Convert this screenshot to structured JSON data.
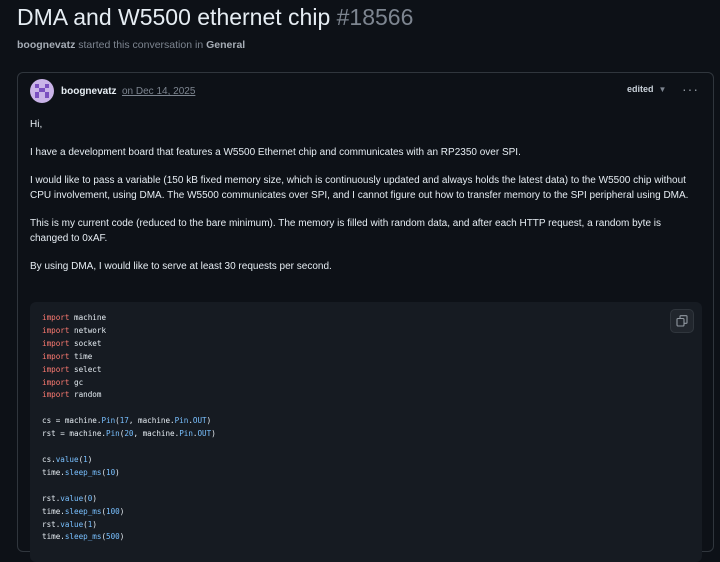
{
  "discussion": {
    "title": "DMA and W5500 ethernet chip",
    "number": "#18566",
    "author": "boognevatz",
    "started_text": "started this conversation in",
    "category": "General"
  },
  "post": {
    "author": "boognevatz",
    "date": "on Dec 14, 2025",
    "edited_label": "edited",
    "paragraphs": [
      "Hi,",
      "I have a development board that features a W5500 Ethernet chip and communicates with an RP2350 over SPI.",
      "I would like to pass a variable (150 kB fixed memory size, which is continuously updated and always holds the latest data) to the W5500 chip without CPU involvement, using DMA. The W5500 communicates over SPI, and I cannot figure out how to transfer memory to the SPI peripheral using DMA.",
      "This is my current code (reduced to the bare minimum). The memory is filled with random data, and after each HTTP request, a random byte is changed to 0xAF.",
      "By using DMA, I would like to serve at least 30 requests per second."
    ]
  },
  "code": {
    "imports": [
      "machine",
      "network",
      "socket",
      "time",
      "select",
      "gc",
      "random"
    ],
    "keyword_import": "import",
    "lines": [
      {
        "pre": "cs = machine.",
        "fn": "Pin",
        "a": "(",
        "n1": "17",
        "b": ", machine.",
        "c": "Pin",
        "d": ".",
        "e": "OUT",
        "f": ")"
      },
      {
        "pre": "rst = machine.",
        "fn": "Pin",
        "a": "(",
        "n1": "20",
        "b": ", machine.",
        "c": "Pin",
        "d": ".",
        "e": "OUT",
        "f": ")"
      }
    ],
    "calls": [
      {
        "obj": "cs.",
        "fn": "value",
        "arg": "1"
      },
      {
        "obj": "time.",
        "fn": "sleep_ms",
        "arg": "10"
      },
      {
        "obj": "rst.",
        "fn": "value",
        "arg": "0"
      },
      {
        "obj": "time.",
        "fn": "sleep_ms",
        "arg": "100"
      },
      {
        "obj": "rst.",
        "fn": "value",
        "arg": "1"
      },
      {
        "obj": "time.",
        "fn": "sleep_ms",
        "arg": "500"
      }
    ]
  },
  "colors": {
    "background": "#0d1117",
    "keyword": "#ff7b72",
    "function": "#79c0ff",
    "muted": "#7d8590"
  }
}
